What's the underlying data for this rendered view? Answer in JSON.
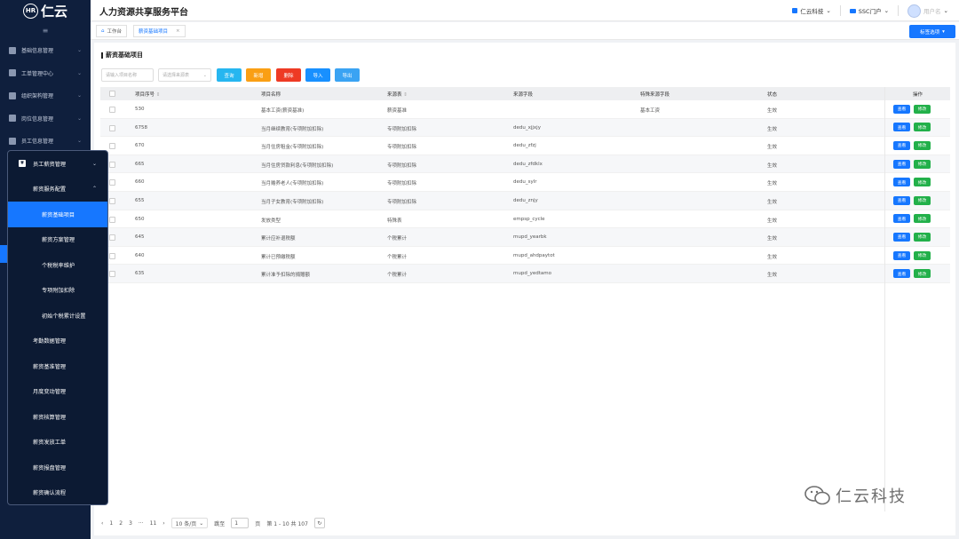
{
  "app": {
    "logo_text": "仁云",
    "logo_badge": "HR",
    "title": "人力资源共享服务平台"
  },
  "header": {
    "company": "仁云科技",
    "portal": "SSC门户",
    "user": "用户名"
  },
  "tabs": [
    {
      "label": "工作台"
    },
    {
      "label": "薪资基础项目"
    }
  ],
  "top_button": {
    "label": "标签选项"
  },
  "sidebar": {
    "collapse_icon": "≡",
    "items": [
      {
        "label": "基础信息管理"
      },
      {
        "label": "工单管理中心"
      },
      {
        "label": "组织架构管理"
      },
      {
        "label": "岗位信息管理"
      },
      {
        "label": "员工信息管理"
      }
    ]
  },
  "popup": {
    "items": [
      {
        "label": "员工薪资管理",
        "badge": "¥"
      },
      {
        "label": "薪资服务配置"
      },
      {
        "label": "薪资基础项目"
      },
      {
        "label": "薪资方案管理"
      },
      {
        "label": "个税税率维护"
      },
      {
        "label": "专项附加扣除"
      },
      {
        "label": "初始个税累计设置"
      },
      {
        "label": "考勤数据管理"
      },
      {
        "label": "薪资基准管理"
      },
      {
        "label": "月度变动管理"
      },
      {
        "label": "薪资核算管理"
      },
      {
        "label": "薪资发放工单"
      },
      {
        "label": "薪资报盘管理"
      },
      {
        "label": "薪资确认流程"
      }
    ]
  },
  "content": {
    "title": "薪资基础项目",
    "search_placeholder": "请输入项目名称",
    "select_placeholder": "请选择来源表",
    "buttons": {
      "query": "查询",
      "add": "新增",
      "delete": "删除",
      "import": "导入",
      "export": "导出"
    },
    "columns": [
      "项目序号",
      "项目名称",
      "来源表",
      "来源字段",
      "特殊来源字段",
      "状态",
      "操作"
    ],
    "rows": [
      {
        "id": "530",
        "name": "基本工资(薪资基准)",
        "src": "薪资基准",
        "field": "",
        "special": "基本工资",
        "status": "生效"
      },
      {
        "id": "6758",
        "name": "当月继续教育(专项附加扣除)",
        "src": "专项附加扣除",
        "field": "dedu_xjjxjy",
        "special": "",
        "status": "生效"
      },
      {
        "id": "670",
        "name": "当月住房租金(专项附加扣除)",
        "src": "专项附加扣除",
        "field": "dedu_zfzj",
        "special": "",
        "status": "生效"
      },
      {
        "id": "665",
        "name": "当月住房贷款利息(专项附加扣除)",
        "src": "专项附加扣除",
        "field": "dedu_zfdklx",
        "special": "",
        "status": "生效"
      },
      {
        "id": "660",
        "name": "当月赡养老人(专项附加扣除)",
        "src": "专项附加扣除",
        "field": "dedu_sylr",
        "special": "",
        "status": "生效"
      },
      {
        "id": "655",
        "name": "当月子女教育(专项附加扣除)",
        "src": "专项附加扣除",
        "field": "dedu_znjy",
        "special": "",
        "status": "生效"
      },
      {
        "id": "650",
        "name": "发放类型",
        "src": "特殊表",
        "field": "empsp_cycle",
        "special": "",
        "status": "生效"
      },
      {
        "id": "645",
        "name": "累计应补退税额",
        "src": "个税累计",
        "field": "mupd_yearbk",
        "special": "",
        "status": "生效"
      },
      {
        "id": "640",
        "name": "累计已预缴税额",
        "src": "个税累计",
        "field": "mupd_ahdpaytot",
        "special": "",
        "status": "生效"
      },
      {
        "id": "635",
        "name": "累计准予扣除的捐赠额",
        "src": "个税累计",
        "field": "mupd_yedtamo",
        "special": "",
        "status": "生效"
      }
    ],
    "row_actions": {
      "view": "查看",
      "edit": "修改"
    },
    "pager": {
      "pages": [
        "1",
        "2",
        "3",
        "···",
        "11"
      ],
      "page_size": "10 条/页",
      "goto_label": "跳至",
      "goto_value": "1",
      "page_suffix": "页",
      "summary": "第 1 - 10 共 107"
    }
  },
  "watermark": {
    "text": "仁云科技"
  },
  "colors": {
    "sidebar": "#0f1f3d",
    "primary": "#1677ff",
    "query": "#26b6f0",
    "add": "#fa9f14",
    "delete": "#ee3a24",
    "import": "#1890ff",
    "export": "#3aa3f3",
    "edit": "#22b04a"
  }
}
